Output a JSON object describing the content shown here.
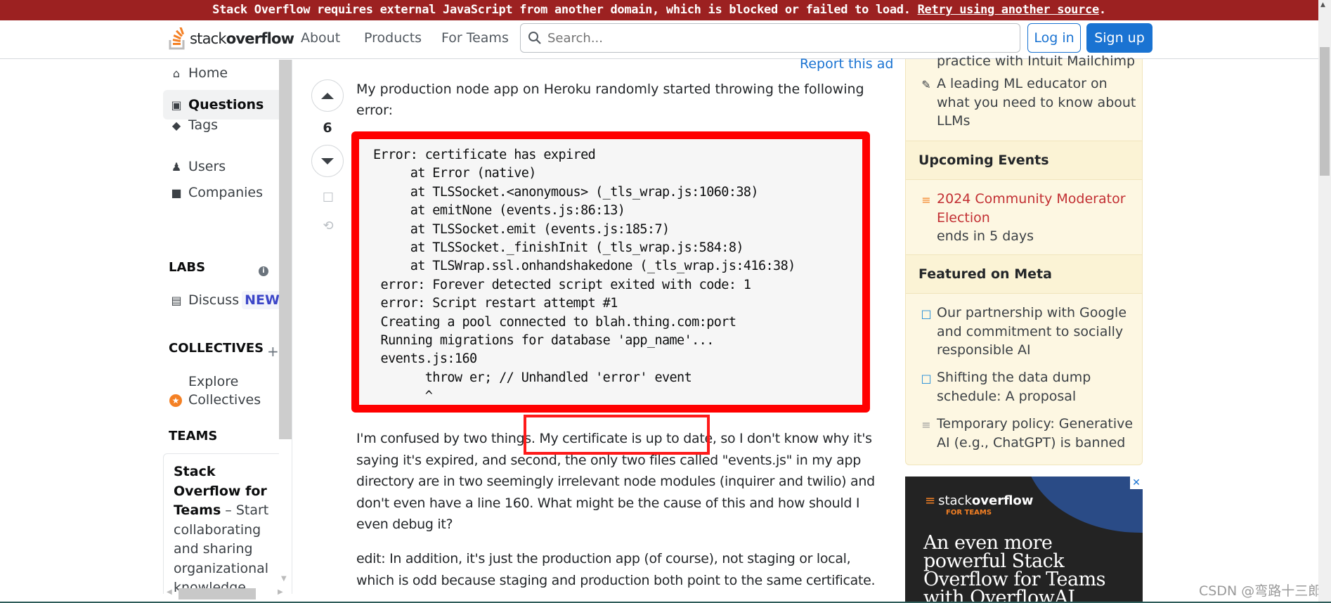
{
  "banner": {
    "message": "Stack Overflow requires external JavaScript from another domain, which is blocked or failed to load.",
    "retry_link": "Retry using another source",
    "end": "."
  },
  "header": {
    "logo_text_light": "stack",
    "logo_text_bold": "overflow",
    "nav": [
      "About",
      "Products",
      "For Teams"
    ],
    "search_placeholder": "Search...",
    "login_label": "Log in",
    "signup_label": "Sign up"
  },
  "left_sidebar": {
    "items": [
      {
        "label": "Home",
        "icon": "home-icon"
      },
      {
        "label": "Questions",
        "icon": "questions-icon",
        "active": true
      },
      {
        "label": "Tags",
        "icon": "tag-icon"
      },
      {
        "label": "Users",
        "icon": "users-icon"
      },
      {
        "label": "Companies",
        "icon": "briefcase-icon"
      }
    ],
    "labs_heading": "LABS",
    "discuss_label": "Discuss",
    "new_badge": "NEW",
    "collectives_heading": "COLLECTIVES",
    "explore_collectives_line1": "Explore",
    "explore_collectives_line2": "Collectives",
    "teams_heading": "TEAMS",
    "teams_card_bold": "Stack Overflow for Teams",
    "teams_card_text": " – Start collaborating and sharing organizational knowledge."
  },
  "question": {
    "report_ad": "Report this ad",
    "vote_count": "6",
    "intro": "My production node app on Heroku randomly started throwing the following error:",
    "code_lines": [
      "Error: certificate has expired",
      "     at Error (native)",
      "     at TLSSocket.<anonymous> (_tls_wrap.js:1060:38)",
      "     at emitNone (events.js:86:13)",
      "     at TLSSocket.emit (events.js:185:7)",
      "     at TLSSocket._finishInit (_tls_wrap.js:584:8)",
      "     at TLSWrap.ssl.onhandshakedone (_tls_wrap.js:416:38)",
      " error: Forever detected script exited with code: 1",
      " error: Script restart attempt #1",
      " Creating a pool connected to blah.thing.com:port",
      " Running migrations for database 'app_name'...",
      " events.js:160",
      "       throw er; // Unhandled 'error' event",
      "       ^"
    ],
    "paragraph2": "I'm confused by two things. My certificate is up to date, so I don't know why it's saying it's expired, and second, the only two files called \"events.js\" in my app directory are in two seemingly irrelevant node modules (inquirer and twilio) and don't even have a line 160. What might be the cause of this and how should I even debug it?",
    "paragraph3": "edit: In addition, it's just the production app (of course), not staging or local, which is odd because staging and production both point to the same certificate.",
    "highlighted_phrase": "My certificate is up to date,"
  },
  "right_sidebar": {
    "blog_partial": "practice with Intuit Mailchimp",
    "blog_item": "A leading ML educator on what you need to know about LLMs",
    "events_heading": "Upcoming Events",
    "event_title": "2024 Community Moderator Election",
    "event_sub": "ends in 5 days",
    "meta_heading": "Featured on Meta",
    "meta_items": [
      "Our partnership with Google and commitment to socially responsible AI",
      "Shifting the data dump schedule: A proposal",
      "Temporary policy: Generative AI (e.g., ChatGPT) is banned"
    ]
  },
  "ad": {
    "logo_light": "stack",
    "logo_bold": "overflow",
    "sub": "FOR TEAMS",
    "headline": "An even more powerful Stack Overflow for Teams with OverflowAI",
    "close": "✕"
  },
  "watermark": "CSDN @弯路十三郎",
  "colors": {
    "banner_bg": "#9c2121",
    "brand_blue": "#1a73d2",
    "highlight_red": "#ff0000",
    "sidebar_yellow": "#fdf7e2",
    "event_red": "#c22e32"
  }
}
